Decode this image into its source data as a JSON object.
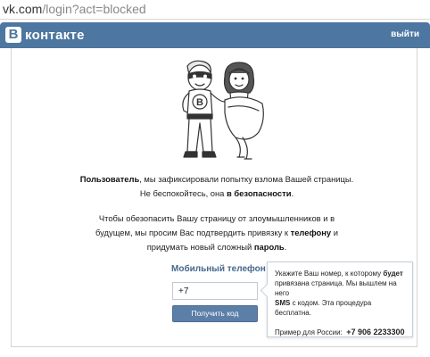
{
  "browser": {
    "url_host": "vk.com",
    "url_path": "/login?act=blocked"
  },
  "header": {
    "logo_letter": "B",
    "logo_text": "контакте",
    "logout_label": "выйти",
    "bar_color": "#4d76a1"
  },
  "message": {
    "line1_bold": "Пользователь",
    "line1_rest": ", мы зафиксировали попытку взлома Вашей страницы.",
    "line2_start": "Не беспокойтесь, она ",
    "line2_bold": "в безопасности",
    "line2_end": ".",
    "para2_line1": "Чтобы обезопасить Вашу страницу от злоумышленников и в",
    "para2_line2_start": "будущем, мы просим Вас подтвердить привязку к ",
    "para2_line2_bold": "телефону",
    "para2_line2_end": " и",
    "para2_line3_start": "придумать новый сложный ",
    "para2_line3_bold": "пароль",
    "para2_line3_end": "."
  },
  "form": {
    "phone_label": "Мобильный телефон",
    "phone_value": "+7",
    "submit_label": "Получить код"
  },
  "tooltip": {
    "line1_start": "Укажите Ваш номер, к которому ",
    "line1_bold": "будет",
    "line2": "привязана страница. Мы вышлем на него",
    "line3_bold": "SMS",
    "line3_rest": " с кодом. Эта процедура бесплатна.",
    "example_label": "Пример для России:",
    "example_number": "+7 906 2233300"
  },
  "icons": {
    "mascot": "superhero-couple-illustration"
  }
}
